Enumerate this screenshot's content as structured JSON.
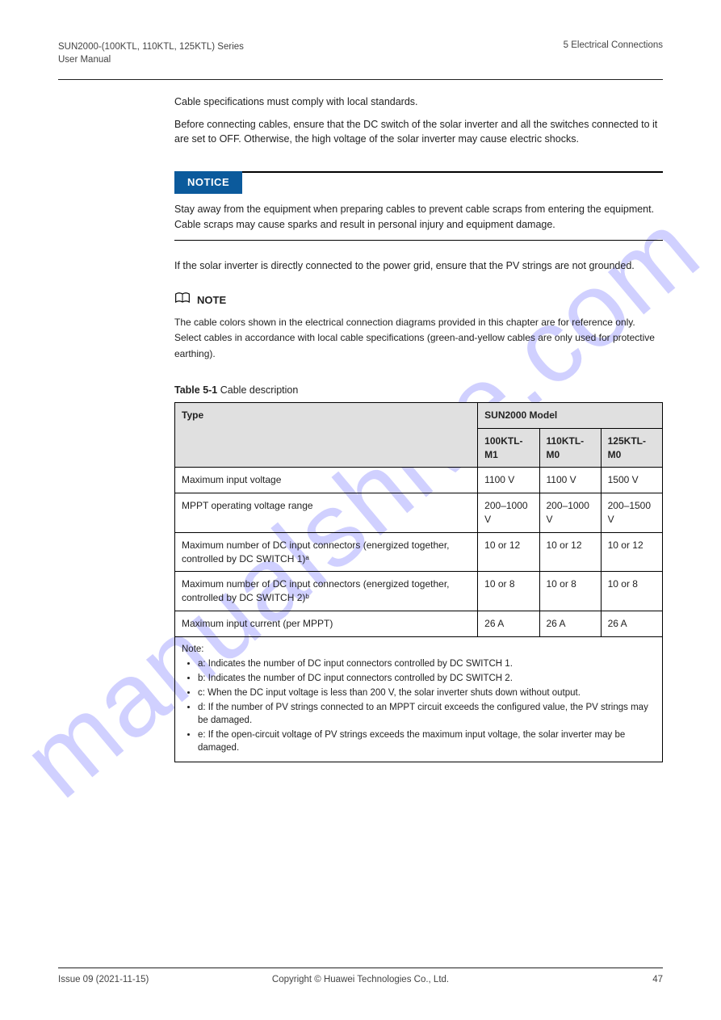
{
  "watermark": "manualshive.com",
  "header": {
    "left": "SUN2000-(100KTL, 110KTL, 125KTL) Series\nUser Manual",
    "right": "5 Electrical Connections"
  },
  "body": {
    "intro1": "Cable specifications must comply with local standards.",
    "intro2": "Before connecting cables, ensure that the DC switch of the solar inverter and all the switches connected to it are set to OFF. Otherwise, the high voltage of the solar inverter may cause electric shocks.",
    "usepara": "If the solar inverter is directly connected to the power grid, ensure that the PV strings are not grounded."
  },
  "notice": {
    "label": "NOTICE",
    "text": "Stay away from the equipment when preparing cables to prevent cable scraps from entering the equipment. Cable scraps may cause sparks and result in personal injury and equipment damage."
  },
  "note": {
    "label": "NOTE",
    "text": "The cable colors shown in the electrical connection diagrams provided in this chapter are for reference only. Select cables in accordance with local cable specifications (green-and-yellow cables are only used for protective earthing)."
  },
  "table": {
    "caption_bold": "Table 5-1",
    "caption_rest": "Cable description",
    "head": {
      "type": "Type",
      "model": "SUN2000 Model",
      "models": [
        "100KTL-M1",
        "110KTL-M0",
        "125KTL-M0"
      ]
    },
    "rows": [
      [
        "Maximum input voltage",
        "1100 V",
        "1100 V",
        "1500 V"
      ],
      [
        "MPPT operating voltage range",
        "200–1000 V",
        "200–1000 V",
        "200–1500 V"
      ],
      [
        "Maximum number of DC input connectors (energized together, controlled by DC SWITCH 1)ᵃ",
        "10 or 12",
        "10 or 12",
        "10 or 12"
      ],
      [
        "Maximum number of DC input connectors (energized together, controlled by DC SWITCH 2)ᵇ",
        "10 or 8",
        "10 or 8",
        "10 or 8"
      ],
      [
        "Maximum input current (per MPPT)",
        "26 A",
        "26 A",
        "26 A"
      ]
    ],
    "footnote_intro": "Note:",
    "footnotes": [
      "a: Indicates the number of DC input connectors controlled by DC SWITCH 1.",
      "b: Indicates the number of DC input connectors controlled by DC SWITCH 2.",
      "c: When the DC input voltage is less than 200 V, the solar inverter shuts down without output.",
      "d: If the number of PV strings connected to an MPPT circuit exceeds the configured value, the PV strings may be damaged.",
      "e: If the open-circuit voltage of PV strings exceeds the maximum input voltage, the solar inverter may be damaged."
    ]
  },
  "footer": {
    "left": "Issue 09 (2021-11-15)",
    "center": "Copyright © Huawei Technologies Co., Ltd.",
    "right": "47"
  }
}
